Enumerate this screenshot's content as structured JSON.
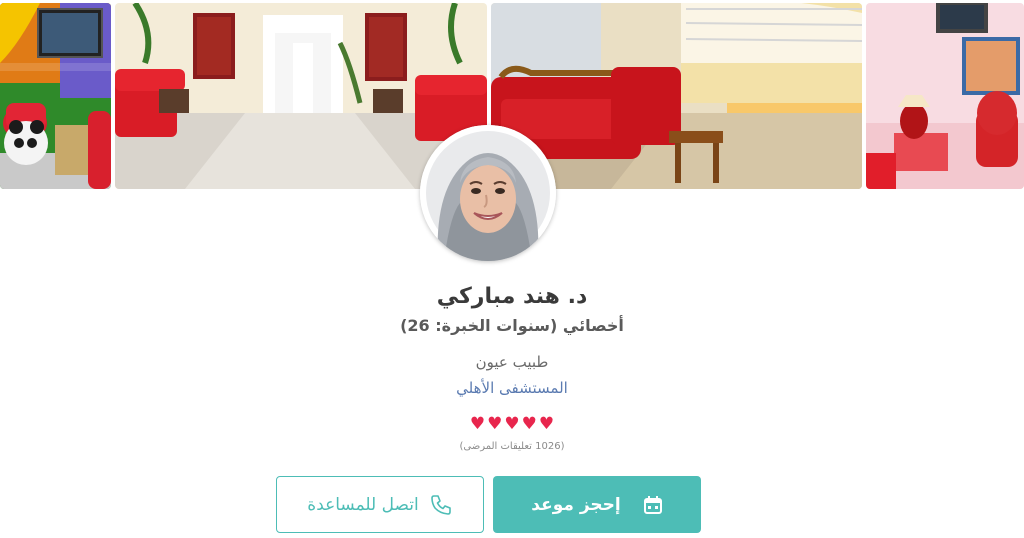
{
  "doctor": {
    "name": "د. هند مباركي",
    "title": "أخصائي (سنوات الخبرة: 26)",
    "specialty": "طبيب عيون",
    "hospital": "المستشفى الأهلي",
    "rating": 5,
    "reviews_text": "(1026 تعليقات المرضى)"
  },
  "actions": {
    "book_label": "إحجز موعد",
    "book_icon": "calendar-icon",
    "call_label": "اتصل للمساعدة",
    "call_icon": "phone-icon"
  },
  "colors": {
    "accent": "#4dbdb6",
    "heart": "#e8264d",
    "hospital_link": "#5b7bb1",
    "name_text": "#3a3a3a"
  }
}
